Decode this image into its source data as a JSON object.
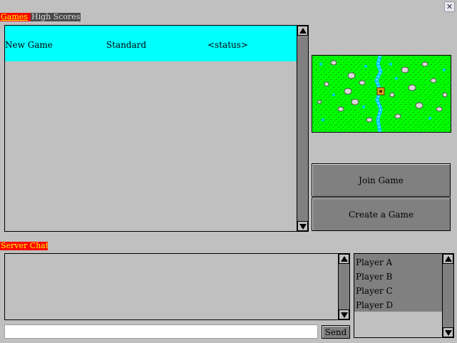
{
  "window": {
    "close_icon": "close-icon"
  },
  "tabs": {
    "games": "Games",
    "high_scores": "High Scores"
  },
  "games_table": {
    "rows": [
      {
        "name": "New Game",
        "type": "Standard",
        "status": "<status>"
      }
    ]
  },
  "buttons": {
    "join": "Join Game",
    "create": "Create a Game"
  },
  "chat": {
    "label": "Server Chat",
    "input_value": "",
    "send_label": "Send"
  },
  "players": [
    "Player A",
    "Player B",
    "Player C",
    "Player D"
  ],
  "colors": {
    "active_tab": "#ff0000",
    "selected_row": "#00ffff",
    "map_grass": "#00ff00"
  }
}
